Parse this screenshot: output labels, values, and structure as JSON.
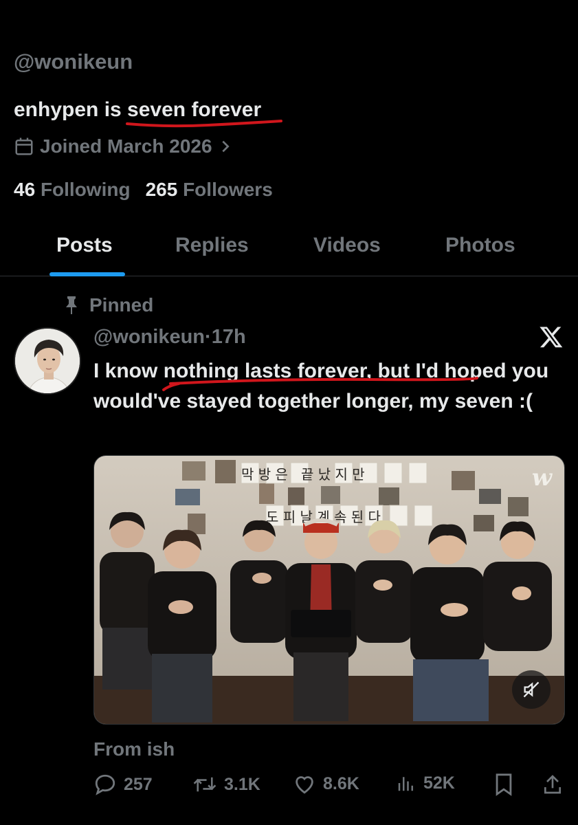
{
  "profile": {
    "handle": "@wonikeun",
    "bio_prefix": "enhypen is ",
    "bio_highlight": "seven forever",
    "joined": "Joined March 2026",
    "following_count": "46",
    "following_label": "Following",
    "followers_count": "265",
    "followers_label": "Followers"
  },
  "tabs": [
    {
      "label": "Posts",
      "active": true
    },
    {
      "label": "Replies",
      "active": false
    },
    {
      "label": "Videos",
      "active": false
    },
    {
      "label": "Photos",
      "active": false
    }
  ],
  "post": {
    "pinned_label": "Pinned",
    "handle": "@wonikeun",
    "separator": "·",
    "time": "17h",
    "text_start": "I know ",
    "text_highlight": "nothing lasts forever,",
    "text_end": " but I'd hoped you would've stayed together longer, my seven :(",
    "media_banner_row1": "막 방 은   끝 났 지 만",
    "media_banner_row2": "도 피 날 계 속 된 다",
    "media_logo": "w",
    "caption": "From ish",
    "stats": {
      "replies": "257",
      "reposts": "3.1K",
      "likes": "8.6K",
      "views": "52K"
    }
  },
  "colors": {
    "background": "#000000",
    "text_primary": "#e7e9ea",
    "text_secondary": "#71767b",
    "accent": "#1d9bf0",
    "annotation": "#d0161c"
  }
}
